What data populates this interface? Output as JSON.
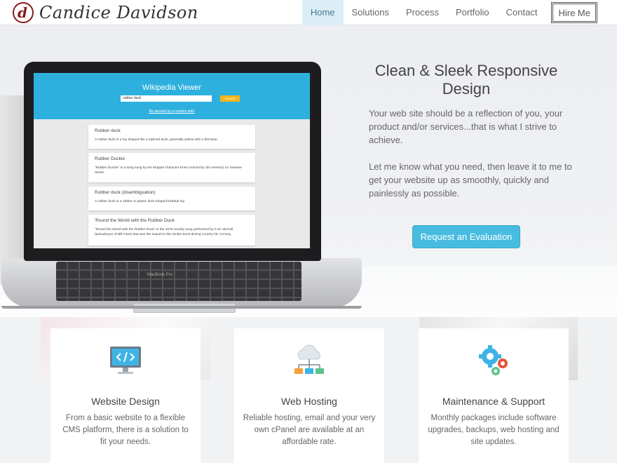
{
  "brand": {
    "name": "Candice Davidson",
    "logo_letter": "d"
  },
  "nav": {
    "items": [
      {
        "label": "Home",
        "active": true
      },
      {
        "label": "Solutions",
        "active": false
      },
      {
        "label": "Process",
        "active": false
      },
      {
        "label": "Portfolio",
        "active": false
      },
      {
        "label": "Contact",
        "active": false
      }
    ],
    "hire_label": "Hire Me"
  },
  "hero": {
    "title": "Clean & Sleek Responsive Design",
    "paragraph1": "Your web site should be a reflection of you, your product and/or services...that is what I strive to achieve.",
    "paragraph2": "Let me know what you need, then leave it to me to get your website up as smoothly, quickly and painlessly as possible.",
    "cta_label": "Request an Evaluation",
    "laptop_model": "MacBook Pro",
    "screen": {
      "title": "Wikipedia Viewer",
      "search_value": "rubber duck",
      "search_button": "Search",
      "random_link": "Be dazzled by a random wiki!",
      "results": [
        {
          "title": "Rubber duck",
          "desc": "A rubber duck is a toy shaped like a stylized duck, generally yellow with a flat base."
        },
        {
          "title": "Rubber Duckie",
          "desc": "\"Rubber Duckie\" is a song sung by the Muppet character Ernie (voiced by Jim Henson) on Sesame Street."
        },
        {
          "title": "Rubber duck (disambiguation)",
          "desc": "A rubber duck is a rubber or plastic duck-shaped bathtub toy."
        },
        {
          "title": "'Round the World with the Rubber Duck",
          "desc": "\"Round the World with the Rubber Duck\" is the 1976 novelty song performed by C.W. McCall (pseudonym of Bill Fries) that was the sequel to the similar truck-driving country hit, Convoy."
        }
      ]
    }
  },
  "services": [
    {
      "icon": "code-monitor-icon",
      "title": "Website Design",
      "desc": "From a basic website to a flexible CMS platform, there is a solution to fit your needs."
    },
    {
      "icon": "cloud-network-icon",
      "title": "Web Hosting",
      "desc": "Reliable hosting, email and your very own cPanel are available at an affordable rate."
    },
    {
      "icon": "gears-icon",
      "title": "Maintenance & Support",
      "desc": "Monthly packages include software upgrades, backups, web hosting and site updates."
    }
  ],
  "colors": {
    "accent": "#47bce0",
    "nav_active_bg": "#dbeef6",
    "brand_red": "#8b1a1a",
    "wiki_blue": "#2eb0de",
    "wiki_search": "#f5b41a"
  }
}
